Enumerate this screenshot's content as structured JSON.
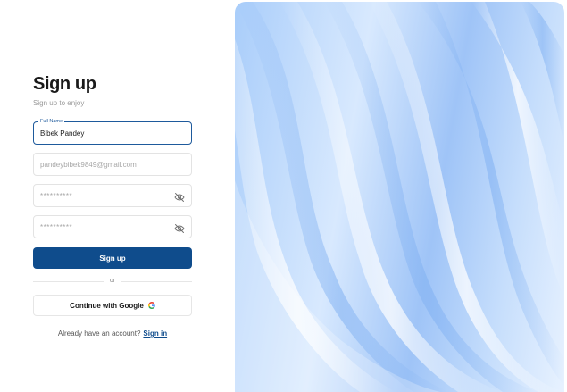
{
  "form": {
    "title": "Sign up",
    "subtitle": "Sign up to enjoy",
    "full_name": {
      "legend": "Full Name",
      "value": "Bibek Pandey"
    },
    "email": {
      "placeholder": "pandeybibek9849@gmail.com"
    },
    "password": {
      "placeholder": "**********"
    },
    "confirm_password": {
      "placeholder": "**********"
    },
    "signup_label": "Sign up",
    "divider_label": "or",
    "google_label": "Continue with Google",
    "footer_text": "Already have an account?",
    "signin_label": "Sign in"
  },
  "colors": {
    "primary": "#0f4c8c",
    "focus_border": "#1e5a9c",
    "art_blue_light": "#d8e9fe",
    "art_blue_dark": "#9fc4f7"
  },
  "icons": {
    "password_toggle": "eye-off-icon",
    "google": "google-g-icon"
  }
}
